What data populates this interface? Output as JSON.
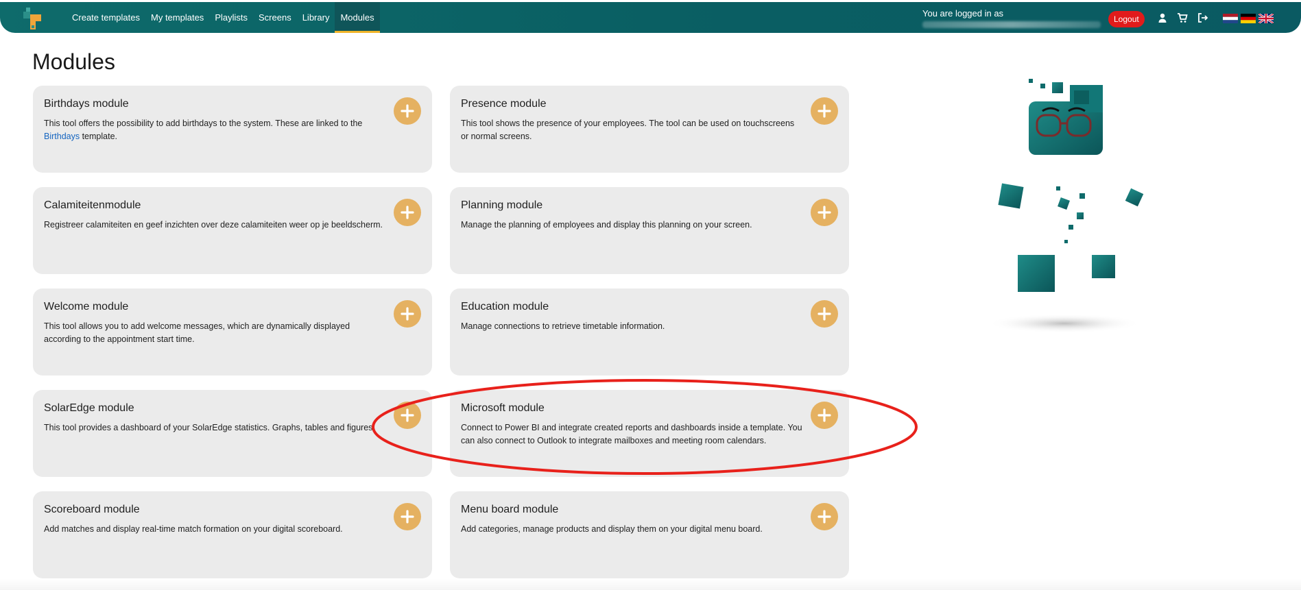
{
  "nav": {
    "items": [
      {
        "label": "Create templates",
        "active": false
      },
      {
        "label": "My templates",
        "active": false
      },
      {
        "label": "Playlists",
        "active": false
      },
      {
        "label": "Screens",
        "active": false
      },
      {
        "label": "Library",
        "active": false
      },
      {
        "label": "Modules",
        "active": true
      }
    ],
    "logged_in_label": "You are logged in as",
    "logout_label": "Logout",
    "icons": [
      "user-icon",
      "cart-icon",
      "sign-out-icon"
    ],
    "flags": [
      "flag-nl-icon",
      "flag-de-icon",
      "flag-uk-icon"
    ]
  },
  "page": {
    "title": "Modules"
  },
  "modules": [
    {
      "title": "Birthdays module",
      "desc_before": "This tool offers the possibility to add birthdays to the system. These are linked to the ",
      "link": "Birthdays",
      "desc_after": " template."
    },
    {
      "title": "Presence module",
      "desc": "This tool shows the presence of your employees. The tool can be used on touchscreens or normal screens."
    },
    {
      "title": "Calamiteitenmodule",
      "desc": "Registreer calamiteiten en geef inzichten over deze calamiteiten weer op je beeldscherm."
    },
    {
      "title": "Planning module",
      "desc": "Manage the planning of employees and display this planning on your screen."
    },
    {
      "title": "Welcome module",
      "desc": "This tool allows you to add welcome messages, which are dynamically displayed according to the appointment start time."
    },
    {
      "title": "Education module",
      "desc": "Manage connections to retrieve timetable information."
    },
    {
      "title": "SolarEdge module",
      "desc": "This tool provides a dashboard of your SolarEdge statistics. Graphs, tables and figures."
    },
    {
      "title": "Microsoft module",
      "desc": "Connect to  Power  BI and integrate created reports and dashboards inside a template. You can also connect to Outlook to integrate mailboxes and meeting room calendars."
    },
    {
      "title": "Scoreboard module",
      "desc": "Add matches and display real-time match formation on your digital scoreboard."
    },
    {
      "title": "Menu board module",
      "desc": "Add categories, manage products and display them on your digital menu board."
    }
  ],
  "colors": {
    "navbar": "#0a5f63",
    "accent_underline": "#f0b429",
    "add_button": "#e5b161",
    "logout": "#e11b1b",
    "card_bg": "#ebebeb",
    "highlight": "#e8211b",
    "link": "#1565c0"
  },
  "icons": {
    "add": "plus-icon",
    "logo": "logo-icon"
  }
}
